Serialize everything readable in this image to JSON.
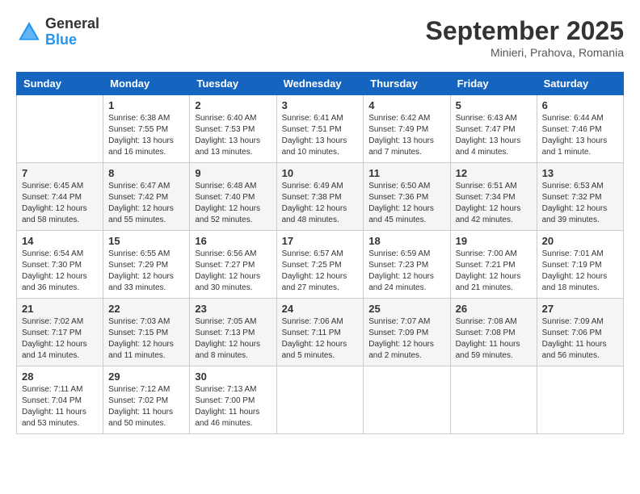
{
  "header": {
    "logo_general": "General",
    "logo_blue": "Blue",
    "month_year": "September 2025",
    "location": "Minieri, Prahova, Romania"
  },
  "columns": [
    "Sunday",
    "Monday",
    "Tuesday",
    "Wednesday",
    "Thursday",
    "Friday",
    "Saturday"
  ],
  "weeks": [
    [
      {
        "day": "",
        "info": ""
      },
      {
        "day": "1",
        "info": "Sunrise: 6:38 AM\nSunset: 7:55 PM\nDaylight: 13 hours\nand 16 minutes."
      },
      {
        "day": "2",
        "info": "Sunrise: 6:40 AM\nSunset: 7:53 PM\nDaylight: 13 hours\nand 13 minutes."
      },
      {
        "day": "3",
        "info": "Sunrise: 6:41 AM\nSunset: 7:51 PM\nDaylight: 13 hours\nand 10 minutes."
      },
      {
        "day": "4",
        "info": "Sunrise: 6:42 AM\nSunset: 7:49 PM\nDaylight: 13 hours\nand 7 minutes."
      },
      {
        "day": "5",
        "info": "Sunrise: 6:43 AM\nSunset: 7:47 PM\nDaylight: 13 hours\nand 4 minutes."
      },
      {
        "day": "6",
        "info": "Sunrise: 6:44 AM\nSunset: 7:46 PM\nDaylight: 13 hours\nand 1 minute."
      }
    ],
    [
      {
        "day": "7",
        "info": "Sunrise: 6:45 AM\nSunset: 7:44 PM\nDaylight: 12 hours\nand 58 minutes."
      },
      {
        "day": "8",
        "info": "Sunrise: 6:47 AM\nSunset: 7:42 PM\nDaylight: 12 hours\nand 55 minutes."
      },
      {
        "day": "9",
        "info": "Sunrise: 6:48 AM\nSunset: 7:40 PM\nDaylight: 12 hours\nand 52 minutes."
      },
      {
        "day": "10",
        "info": "Sunrise: 6:49 AM\nSunset: 7:38 PM\nDaylight: 12 hours\nand 48 minutes."
      },
      {
        "day": "11",
        "info": "Sunrise: 6:50 AM\nSunset: 7:36 PM\nDaylight: 12 hours\nand 45 minutes."
      },
      {
        "day": "12",
        "info": "Sunrise: 6:51 AM\nSunset: 7:34 PM\nDaylight: 12 hours\nand 42 minutes."
      },
      {
        "day": "13",
        "info": "Sunrise: 6:53 AM\nSunset: 7:32 PM\nDaylight: 12 hours\nand 39 minutes."
      }
    ],
    [
      {
        "day": "14",
        "info": "Sunrise: 6:54 AM\nSunset: 7:30 PM\nDaylight: 12 hours\nand 36 minutes."
      },
      {
        "day": "15",
        "info": "Sunrise: 6:55 AM\nSunset: 7:29 PM\nDaylight: 12 hours\nand 33 minutes."
      },
      {
        "day": "16",
        "info": "Sunrise: 6:56 AM\nSunset: 7:27 PM\nDaylight: 12 hours\nand 30 minutes."
      },
      {
        "day": "17",
        "info": "Sunrise: 6:57 AM\nSunset: 7:25 PM\nDaylight: 12 hours\nand 27 minutes."
      },
      {
        "day": "18",
        "info": "Sunrise: 6:59 AM\nSunset: 7:23 PM\nDaylight: 12 hours\nand 24 minutes."
      },
      {
        "day": "19",
        "info": "Sunrise: 7:00 AM\nSunset: 7:21 PM\nDaylight: 12 hours\nand 21 minutes."
      },
      {
        "day": "20",
        "info": "Sunrise: 7:01 AM\nSunset: 7:19 PM\nDaylight: 12 hours\nand 18 minutes."
      }
    ],
    [
      {
        "day": "21",
        "info": "Sunrise: 7:02 AM\nSunset: 7:17 PM\nDaylight: 12 hours\nand 14 minutes."
      },
      {
        "day": "22",
        "info": "Sunrise: 7:03 AM\nSunset: 7:15 PM\nDaylight: 12 hours\nand 11 minutes."
      },
      {
        "day": "23",
        "info": "Sunrise: 7:05 AM\nSunset: 7:13 PM\nDaylight: 12 hours\nand 8 minutes."
      },
      {
        "day": "24",
        "info": "Sunrise: 7:06 AM\nSunset: 7:11 PM\nDaylight: 12 hours\nand 5 minutes."
      },
      {
        "day": "25",
        "info": "Sunrise: 7:07 AM\nSunset: 7:09 PM\nDaylight: 12 hours\nand 2 minutes."
      },
      {
        "day": "26",
        "info": "Sunrise: 7:08 AM\nSunset: 7:08 PM\nDaylight: 11 hours\nand 59 minutes."
      },
      {
        "day": "27",
        "info": "Sunrise: 7:09 AM\nSunset: 7:06 PM\nDaylight: 11 hours\nand 56 minutes."
      }
    ],
    [
      {
        "day": "28",
        "info": "Sunrise: 7:11 AM\nSunset: 7:04 PM\nDaylight: 11 hours\nand 53 minutes."
      },
      {
        "day": "29",
        "info": "Sunrise: 7:12 AM\nSunset: 7:02 PM\nDaylight: 11 hours\nand 50 minutes."
      },
      {
        "day": "30",
        "info": "Sunrise: 7:13 AM\nSunset: 7:00 PM\nDaylight: 11 hours\nand 46 minutes."
      },
      {
        "day": "",
        "info": ""
      },
      {
        "day": "",
        "info": ""
      },
      {
        "day": "",
        "info": ""
      },
      {
        "day": "",
        "info": ""
      }
    ]
  ]
}
